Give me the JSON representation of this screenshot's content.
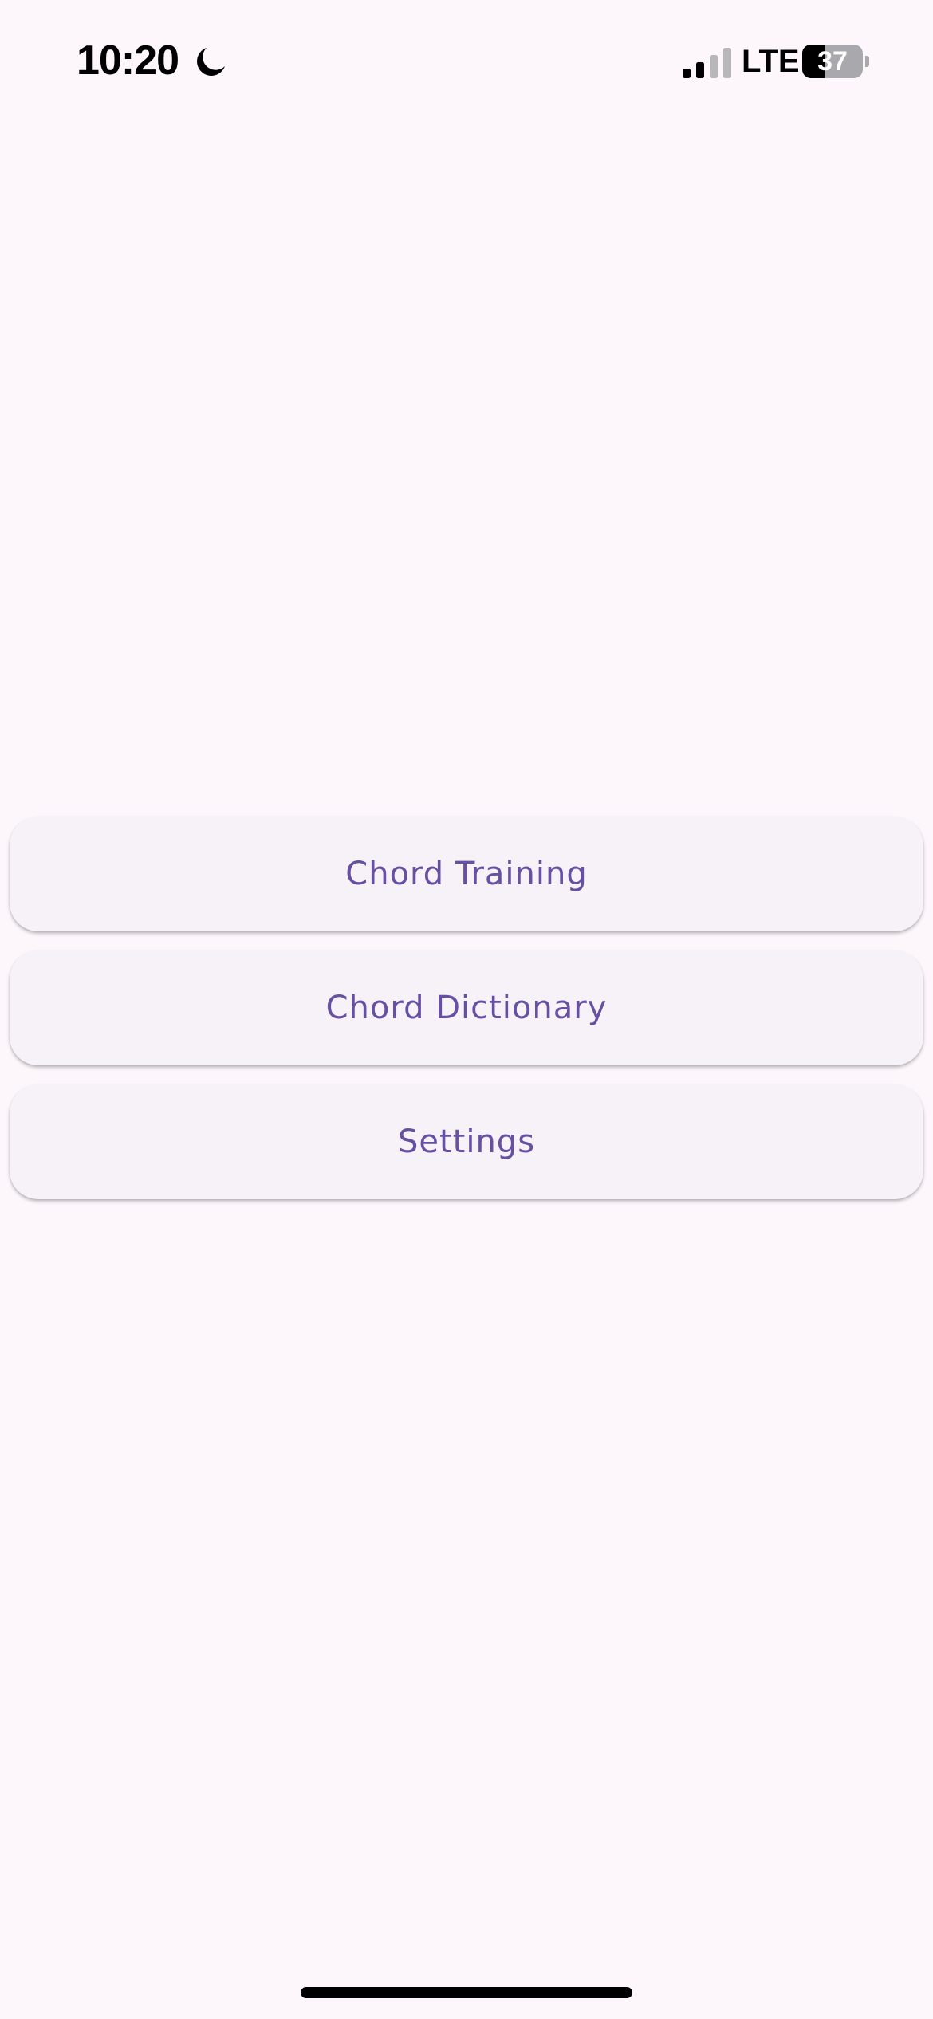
{
  "status_bar": {
    "time": "10:20",
    "focus_icon": "moon-icon",
    "signal_icon": "cellular-signal-icon",
    "network": "LTE",
    "battery_level": "37",
    "battery_fraction": 0.37
  },
  "menu": {
    "items": [
      {
        "label": "Chord Training"
      },
      {
        "label": "Chord Dictionary"
      },
      {
        "label": "Settings"
      }
    ]
  },
  "colors": {
    "background": "#fdf7fc",
    "button_surface": "#f6f2f7",
    "accent_text": "#6750a4"
  }
}
